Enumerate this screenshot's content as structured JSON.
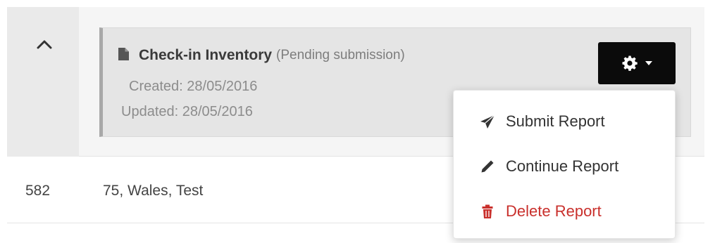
{
  "report": {
    "title": "Check-in Inventory",
    "status": "(Pending submission)",
    "created": "Created: 28/05/2016",
    "updated": "Updated: 28/05/2016"
  },
  "actions_menu": {
    "items": [
      {
        "label": "Submit Report",
        "icon": "paper-plane-icon"
      },
      {
        "label": "Continue Report",
        "icon": "pencil-icon"
      },
      {
        "label": "Delete Report",
        "icon": "trash-icon",
        "color": "#c9302c"
      }
    ]
  },
  "table_row": {
    "id": "582",
    "address": "75, Wales, Test"
  },
  "colors": {
    "button_bg": "#0b0b0b",
    "danger": "#c9302c",
    "card_bg": "#e5e5e5"
  }
}
